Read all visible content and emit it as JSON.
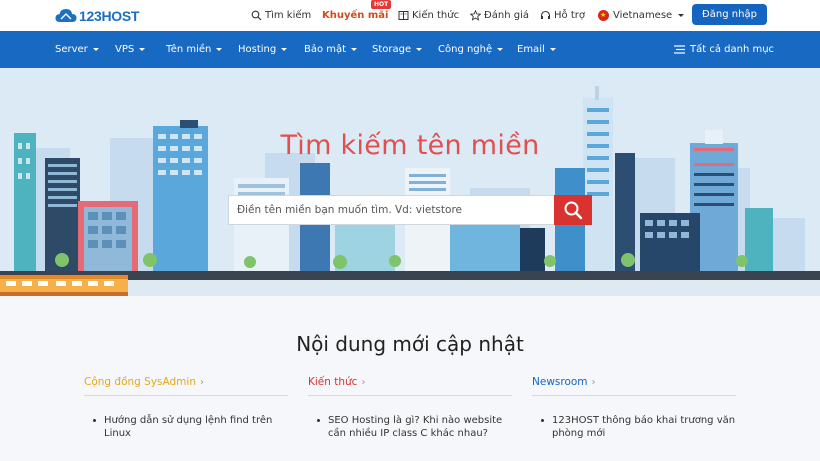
{
  "logo": {
    "text": "123HOST"
  },
  "topnav": {
    "search": "Tìm kiếm",
    "promo": "Khuyến mãi",
    "promo_badge": "HOT",
    "knowledge": "Kiến thức",
    "review": "Đánh giá",
    "support": "Hỗ trợ",
    "language": "Vietnamese",
    "login": "Đăng nhập"
  },
  "mainnav": {
    "items": [
      "Server",
      "VPS",
      "Tên miền",
      "Hosting",
      "Bảo mật",
      "Storage",
      "Công nghệ",
      "Email"
    ],
    "all_categories": "Tất cả danh mục"
  },
  "hero": {
    "title": "Tìm kiếm tên miền",
    "search_placeholder": "Điền tên miền bạn muốn tìm. Vd: vietstore"
  },
  "content": {
    "title": "Nội dung mới cập nhật",
    "columns": [
      {
        "heading": "Cộng đồng SysAdmin",
        "color": "#e6a817",
        "items": [
          "Hướng dẫn sử dụng lệnh find trên Linux"
        ]
      },
      {
        "heading": "Kiến thức",
        "color": "#d9322f",
        "items": [
          "SEO Hosting là gì? Khi nào website cần nhiều IP class C khác nhau?"
        ]
      },
      {
        "heading": "Newsroom",
        "color": "#1565c0",
        "items": [
          "123HOST thông báo khai trương văn phòng mới"
        ]
      }
    ]
  },
  "colors": {
    "brand": "#1769c2",
    "accent": "#d9322f",
    "hero_bg": "#dceaf5"
  }
}
